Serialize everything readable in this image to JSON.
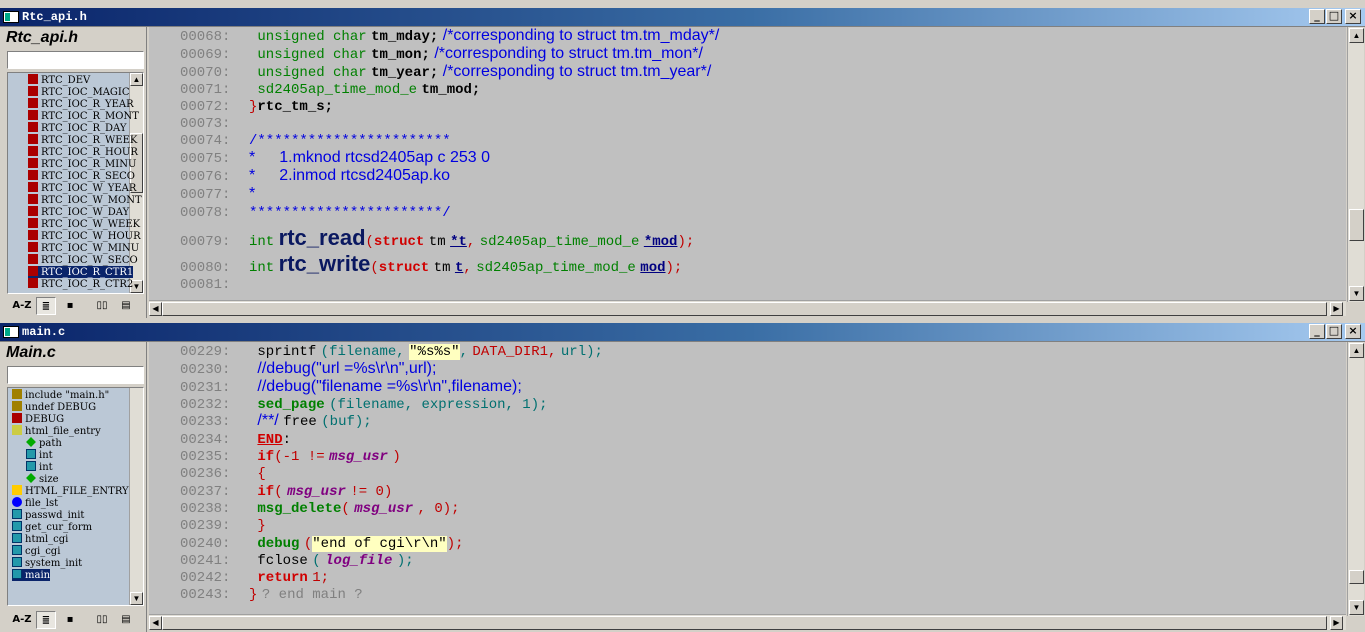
{
  "top": {
    "title": "Rtc_api.h",
    "side_title": "Rtc_api.h",
    "symbols": [
      "RTC_DEV",
      "RTC_IOC_MAGIC",
      "RTC_IOC_R_YEAR",
      "RTC_IOC_R_MONT",
      "RTC_IOC_R_DAY",
      "RTC_IOC_R_WEEK",
      "RTC_IOC_R_HOUR",
      "RTC_IOC_R_MINU",
      "RTC_IOC_R_SECO",
      "RTC_IOC_W_YEAR",
      "RTC_IOC_W_MONT",
      "RTC_IOC_W_DAY",
      "RTC_IOC_W_WEEK",
      "RTC_IOC_W_HOUR",
      "RTC_IOC_W_MINU",
      "RTC_IOC_W_SECO",
      "RTC_IOC_R_CTR1",
      "RTC_IOC_R_CTR2"
    ],
    "selected_symbol": "RTC_IOC_R_CTR1",
    "lines": {
      "n68": "00068:",
      "n69": "00069:",
      "n70": "00070:",
      "n71": "00071:",
      "n72": "00072:",
      "n73": "00073:",
      "n74": "00074:",
      "n75": "00075:",
      "n76": "00076:",
      "n77": "00077:",
      "n78": "00078:",
      "n79": "00079:",
      "n80": "00080:",
      "n81": "00081:",
      "uc": "unsigned char",
      "tm_mday": "tm_mday;",
      "c68": "/*corresponding to struct tm.tm_mday*/",
      "tm_mon": "tm_mon;",
      "c69": "/*corresponding to struct tm.tm_mon*/",
      "tm_year": "tm_year;",
      "c70": "/*corresponding to struct tm.tm_year*/",
      "modtype": "sd2405ap_time_mod_e",
      "tm_mod": "tm_mod;",
      "close72": "}",
      "rtc_tm_s": "rtc_tm_s;",
      "c74": "/***********************",
      "c75a": "*",
      "c75b": "1.mknod rtcsd2405ap c 253 0",
      "c76a": "*",
      "c76b": "2.inmod rtcsd2405ap.ko",
      "c77": "*",
      "c78": "***********************/",
      "int": "int",
      "rtc_read": "rtc_read",
      "rtc_write": "rtc_write",
      "lp": "(",
      "struct": "struct",
      "tm": "tm",
      "star_t": "*t",
      "t": "t",
      ",": ",",
      "star_mod": "*mod",
      "mod": "mod",
      "rp": ");"
    }
  },
  "bottom": {
    "title": "main.c",
    "side_title": "Main.c",
    "symbols": [
      {
        "label": "include \"main.h\"",
        "icon": "hashy",
        "indent": 0
      },
      {
        "label": "undef DEBUG",
        "icon": "hashy",
        "indent": 0
      },
      {
        "label": "DEBUG",
        "icon": "hash",
        "indent": 0
      },
      {
        "label": "html_file_entry",
        "icon": "s",
        "indent": 0
      },
      {
        "label": "path",
        "icon": "dia",
        "indent": 1
      },
      {
        "label": "int",
        "icon": "blue",
        "indent": 1
      },
      {
        "label": "int",
        "icon": "blue",
        "indent": 1
      },
      {
        "label": "size",
        "icon": "dia",
        "indent": 1
      },
      {
        "label": "HTML_FILE_ENTRY",
        "icon": "t",
        "indent": 0
      },
      {
        "label": "file_lst",
        "icon": "ell",
        "indent": 0
      },
      {
        "label": "passwd_init",
        "icon": "blue",
        "indent": 0
      },
      {
        "label": "get_cur_form",
        "icon": "blue",
        "indent": 0
      },
      {
        "label": "html_cgi",
        "icon": "blue",
        "indent": 0
      },
      {
        "label": "cgi_cgi",
        "icon": "blue",
        "indent": 0
      },
      {
        "label": "system_init",
        "icon": "blue",
        "indent": 0
      },
      {
        "label": "main",
        "icon": "blue",
        "indent": 0
      }
    ],
    "selected_symbol": "main",
    "lines": {
      "n229": "00229:",
      "n230": "00230:",
      "n231": "00231:",
      "n232": "00232:",
      "n233": "00233:",
      "n234": "00234:",
      "n235": "00235:",
      "n236": "00236:",
      "n237": "00237:",
      "n238": "00238:",
      "n239": "00239:",
      "n240": "00240:",
      "n241": "00241:",
      "n242": "00242:",
      "n243": "00243:",
      "sprintf": "sprintf",
      "l229a": "(filename,",
      "l229s": "\"%s%s\"",
      "l229b": ",",
      "l229c": "DATA_DIR1,",
      "l229d": "url);",
      "c230": "//debug(\"url =%s\\r\\n\",url);",
      "c231": "//debug(\"filename =%s\\r\\n\",filename);",
      "sed_page": "sed_page",
      "l232": "(filename, expression, 1);",
      "c233": "/**/",
      "l233": "free",
      "l233b": "(buf);",
      "END": "END",
      "colon": ":",
      "if": "if",
      "l235a": "(-1 !=",
      "msg_usr": "msg_usr",
      "l235b": ")",
      "ob": "{",
      "l237a": "(",
      "l237b": "!= 0)",
      "msg_delete": "msg_delete",
      "l238a": "(",
      "l238b": ", 0);",
      "cb": "}",
      "debug": "debug",
      "l240a": "(",
      "l240s": "\"end of cgi\\r\\n\"",
      "l240b": ");",
      "fclose": "fclose",
      "l241a": "(",
      "log_file": "log_file",
      "l241b": ");",
      "return": "return",
      "l242": "1;",
      "l243a": "}",
      "l243b": "? end main ?"
    }
  },
  "toolbar": {
    "az": "A-Z"
  }
}
